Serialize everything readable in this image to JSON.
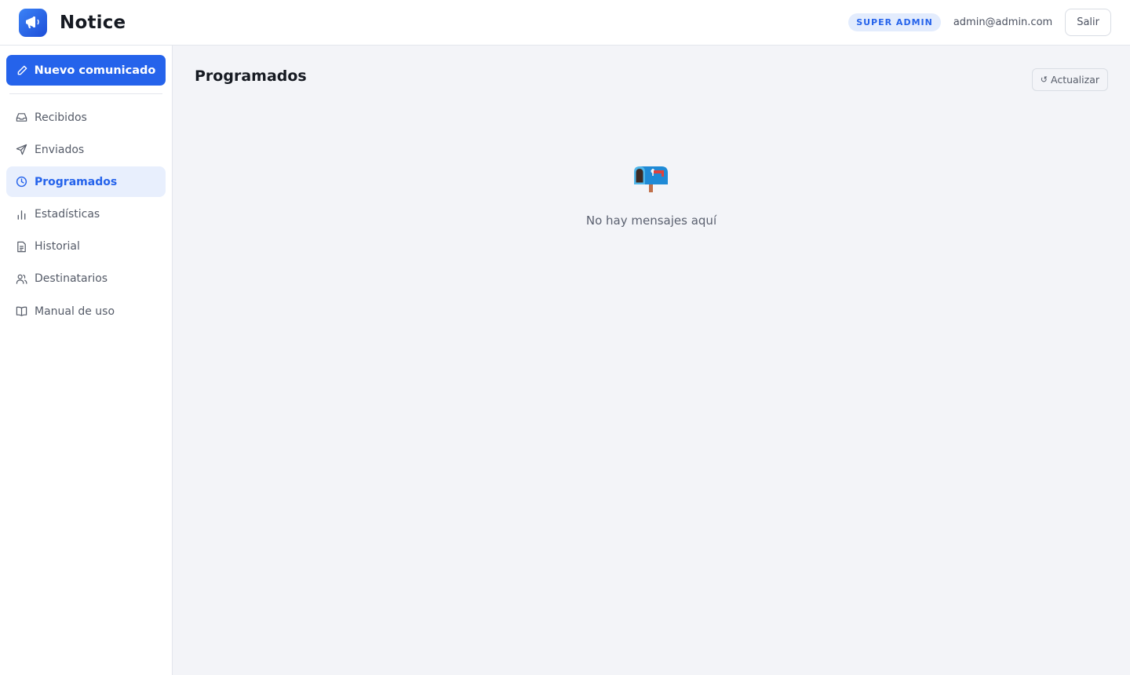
{
  "app": {
    "name": "Notice",
    "logo_icon": "megaphone-icon",
    "accent": "#2563eb"
  },
  "header": {
    "role_badge": "SUPER ADMIN",
    "user_email": "admin@admin.com",
    "logout_label": "Salir"
  },
  "sidebar": {
    "new_button": {
      "label": "Nuevo comunicado",
      "icon": "pencil-icon"
    },
    "items": [
      {
        "label": "Recibidos",
        "icon": "inbox-icon",
        "active": false
      },
      {
        "label": "Enviados",
        "icon": "send-icon",
        "active": false
      },
      {
        "label": "Programados",
        "icon": "clock-icon",
        "active": true
      },
      {
        "label": "Estadísticas",
        "icon": "bar-chart-icon",
        "active": false
      },
      {
        "label": "Historial",
        "icon": "document-icon",
        "active": false
      },
      {
        "label": "Destinatarios",
        "icon": "users-icon",
        "active": false
      },
      {
        "label": "Manual de uso",
        "icon": "book-icon",
        "active": false
      }
    ]
  },
  "main": {
    "title": "Programados",
    "refresh_label": "Actualizar",
    "refresh_icon": "refresh-icon",
    "empty_icon": "mailbox-icon",
    "empty_message": "No hay mensajes aquí"
  }
}
